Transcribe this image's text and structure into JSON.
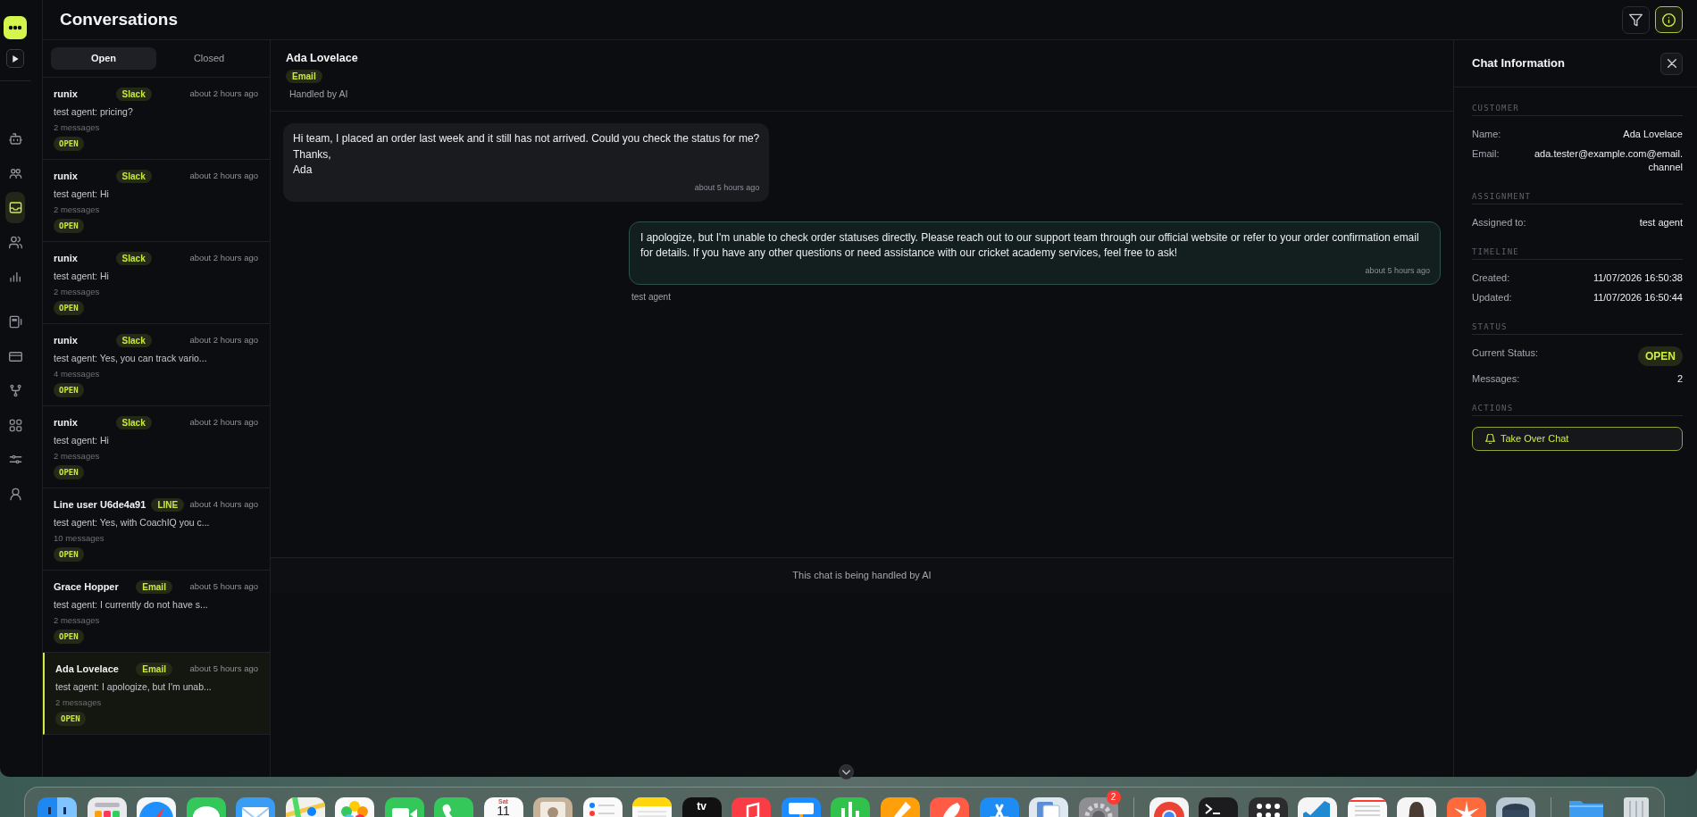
{
  "app": {
    "title": "Conversations"
  },
  "toolbar": [
    {
      "kind": "filter",
      "selected": false
    },
    {
      "kind": "info",
      "selected": true
    }
  ],
  "nav_groups": [
    [
      {
        "kind": "bot",
        "selected": false
      },
      {
        "kind": "team",
        "selected": false
      },
      {
        "kind": "inbox",
        "selected": true
      },
      {
        "kind": "contacts",
        "selected": false
      },
      {
        "kind": "analytics",
        "selected": false
      }
    ],
    [
      {
        "kind": "reports",
        "selected": false
      },
      {
        "kind": "billing",
        "selected": false
      },
      {
        "kind": "workflows",
        "selected": false
      },
      {
        "kind": "apps",
        "selected": false
      },
      {
        "kind": "settings",
        "selected": false
      },
      {
        "kind": "profile",
        "selected": false
      }
    ]
  ],
  "list_tabs": [
    {
      "label": "Open",
      "selected": true
    },
    {
      "label": "Closed",
      "selected": false
    }
  ],
  "conversations": [
    {
      "name": "runix",
      "channel": "Slack",
      "time": "about 2 hours ago",
      "preview": "test agent: pricing?",
      "count": "2 messages",
      "status": "OPEN",
      "selected": false
    },
    {
      "name": "runix",
      "channel": "Slack",
      "time": "about 2 hours ago",
      "preview": "test agent: Hi",
      "count": "2 messages",
      "status": "OPEN",
      "selected": false
    },
    {
      "name": "runix",
      "channel": "Slack",
      "time": "about 2 hours ago",
      "preview": "test agent: Hi",
      "count": "2 messages",
      "status": "OPEN",
      "selected": false
    },
    {
      "name": "runix",
      "channel": "Slack",
      "time": "about 2 hours ago",
      "preview": "test agent: Yes, you can track vario...",
      "count": "4 messages",
      "status": "OPEN",
      "selected": false
    },
    {
      "name": "runix",
      "channel": "Slack",
      "time": "about 2 hours ago",
      "preview": "test agent: Hi",
      "count": "2 messages",
      "status": "OPEN",
      "selected": false
    },
    {
      "name": "Line user U6de4a91",
      "channel": "LINE",
      "time": "about 4 hours ago",
      "preview": "test agent: Yes, with CoachIQ you c...",
      "count": "10 messages",
      "status": "OPEN",
      "selected": false
    },
    {
      "name": "Grace Hopper",
      "channel": "Email",
      "time": "about 5 hours ago",
      "preview": "test agent: I currently do not have s...",
      "count": "2 messages",
      "status": "OPEN",
      "selected": false
    },
    {
      "name": "Ada Lovelace",
      "channel": "Email",
      "time": "about 5 hours ago",
      "preview": "test agent: I apologize, but I'm unab...",
      "count": "2 messages",
      "status": "OPEN",
      "selected": true
    }
  ],
  "chat": {
    "name": "Ada Lovelace",
    "channel": "Email",
    "handler": "Handled by AI",
    "messages": [
      {
        "kind": "customer",
        "text": "Hi team, I placed an order last week and it still has not arrived. Could you check the status for me?\nThanks,\nAda",
        "time": "about 5 hours ago"
      },
      {
        "kind": "agent",
        "text": "I apologize, but I'm unable to check order statuses directly. Please reach out to our support team through our official website or refer to your order confirmation email for details. If you have any other questions or need assistance with our cricket academy services, feel free to ask!",
        "time": "about 5 hours ago",
        "sender": "test agent"
      }
    ],
    "footer": "This chat is being handled by AI"
  },
  "info_panel": {
    "title": "Chat Information",
    "sections": [
      {
        "heading": "CUSTOMER",
        "rows": [
          {
            "kind": "text",
            "label": "Name:",
            "value": "Ada Lovelace"
          },
          {
            "kind": "text",
            "label": "Email:",
            "value": "ada.tester@example.com@email.channel"
          }
        ]
      },
      {
        "heading": "ASSIGNMENT",
        "rows": [
          {
            "kind": "text",
            "label": "Assigned to:",
            "value": "test agent"
          }
        ]
      },
      {
        "heading": "TIMELINE",
        "rows": [
          {
            "kind": "text",
            "label": "Created:",
            "value": "11/07/2026 16:50:38"
          },
          {
            "kind": "text",
            "label": "Updated:",
            "value": "11/07/2026 16:50:44"
          }
        ]
      },
      {
        "heading": "STATUS",
        "rows": [
          {
            "kind": "badge",
            "label": "Current Status:",
            "value": "OPEN"
          },
          {
            "kind": "text",
            "label": "Messages:",
            "value": "2"
          }
        ]
      },
      {
        "heading": "ACTIONS",
        "actions": [
          {
            "label": "Take Over Chat"
          }
        ]
      }
    ]
  },
  "dock": {
    "calendar_weekday": "Sat",
    "calendar_date": "11",
    "tv_label": "tv",
    "settings_badge": "2"
  }
}
